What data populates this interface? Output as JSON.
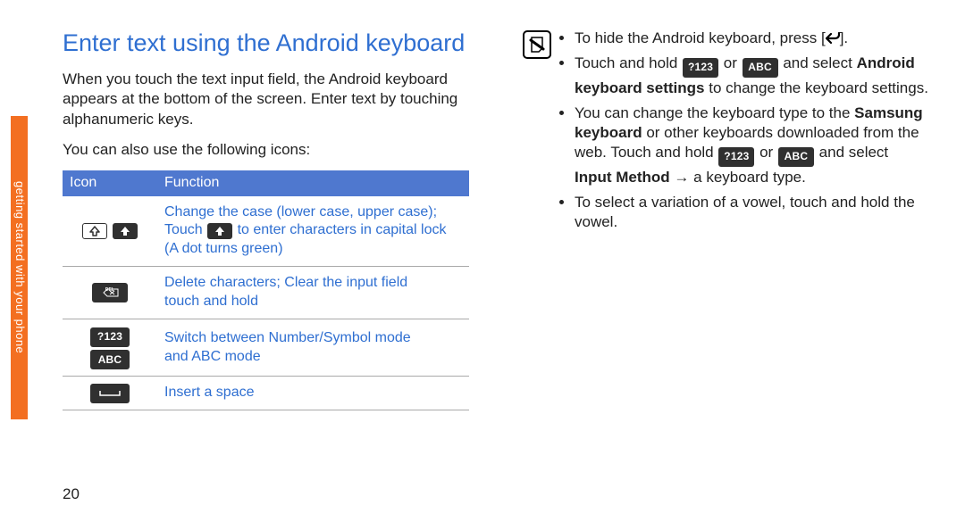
{
  "side_tab": "getting started with your phone",
  "page_number": "20",
  "left": {
    "title": "Enter text using the Android keyboard",
    "intro": "When you touch the text input field, the Android keyboard appears at the bottom of the screen. Enter text by touching alphanumeric keys.",
    "subintro": "You can also use the following icons:",
    "table": {
      "head_icon": "Icon",
      "head_func": "Function",
      "rows": [
        {
          "func_a": "Change the case (lower case, upper case);",
          "func_b": "Touch ",
          "func_c": " to enter characters in capital lock (A dot turns green)"
        },
        {
          "func_a": "Delete characters; Clear the input field",
          "func_b": "touch and hold"
        },
        {
          "func_a": "Switch between Number/Symbol mode",
          "func_b": "and ABC mode"
        },
        {
          "func_a": "Insert a space"
        }
      ]
    }
  },
  "right": {
    "items": {
      "a1": "To hide the Android keyboard, press [",
      "a2": "].",
      "b1": "Touch and hold ",
      "b2": " or ",
      "b3": " and select ",
      "b_bold": "Android keyboard settings",
      "b4": " to change the keyboard settings.",
      "c1": "You can change the keyboard type to the ",
      "c_bold1": "Samsung keyboard",
      "c2": " or other keyboards downloaded from the web. Touch and hold ",
      "c3": " or ",
      "c4": " and select ",
      "c_bold2": "Input Method",
      "c5": " → a keyboard type.",
      "d": "To select a variation of a vowel, touch and hold the vowel."
    }
  },
  "key_labels": {
    "num": "?123",
    "abc": "ABC",
    "del": "DEL"
  }
}
